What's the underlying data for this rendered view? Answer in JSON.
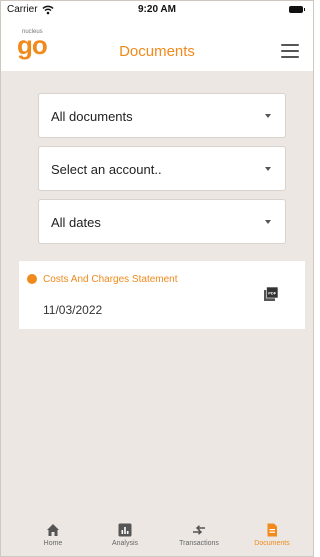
{
  "status_bar": {
    "carrier": "Carrier",
    "time": "9:20 AM"
  },
  "header": {
    "logo_small": "nucleus",
    "logo_main": "go",
    "title": "Documents"
  },
  "filters": [
    {
      "label": "All documents"
    },
    {
      "label": "Select an account.."
    },
    {
      "label": "All dates"
    }
  ],
  "documents": [
    {
      "name": "Costs And Charges Statement",
      "date": "11/03/2022",
      "icon": "pdf-icon"
    }
  ],
  "tabs": [
    {
      "label": "Home",
      "icon": "home-icon"
    },
    {
      "label": "Analysis",
      "icon": "analysis-icon"
    },
    {
      "label": "Transactions",
      "icon": "transactions-icon"
    },
    {
      "label": "Documents",
      "icon": "document-icon",
      "active": true
    }
  ],
  "colors": {
    "accent": "#f08a1c",
    "background": "#ece7e3"
  }
}
